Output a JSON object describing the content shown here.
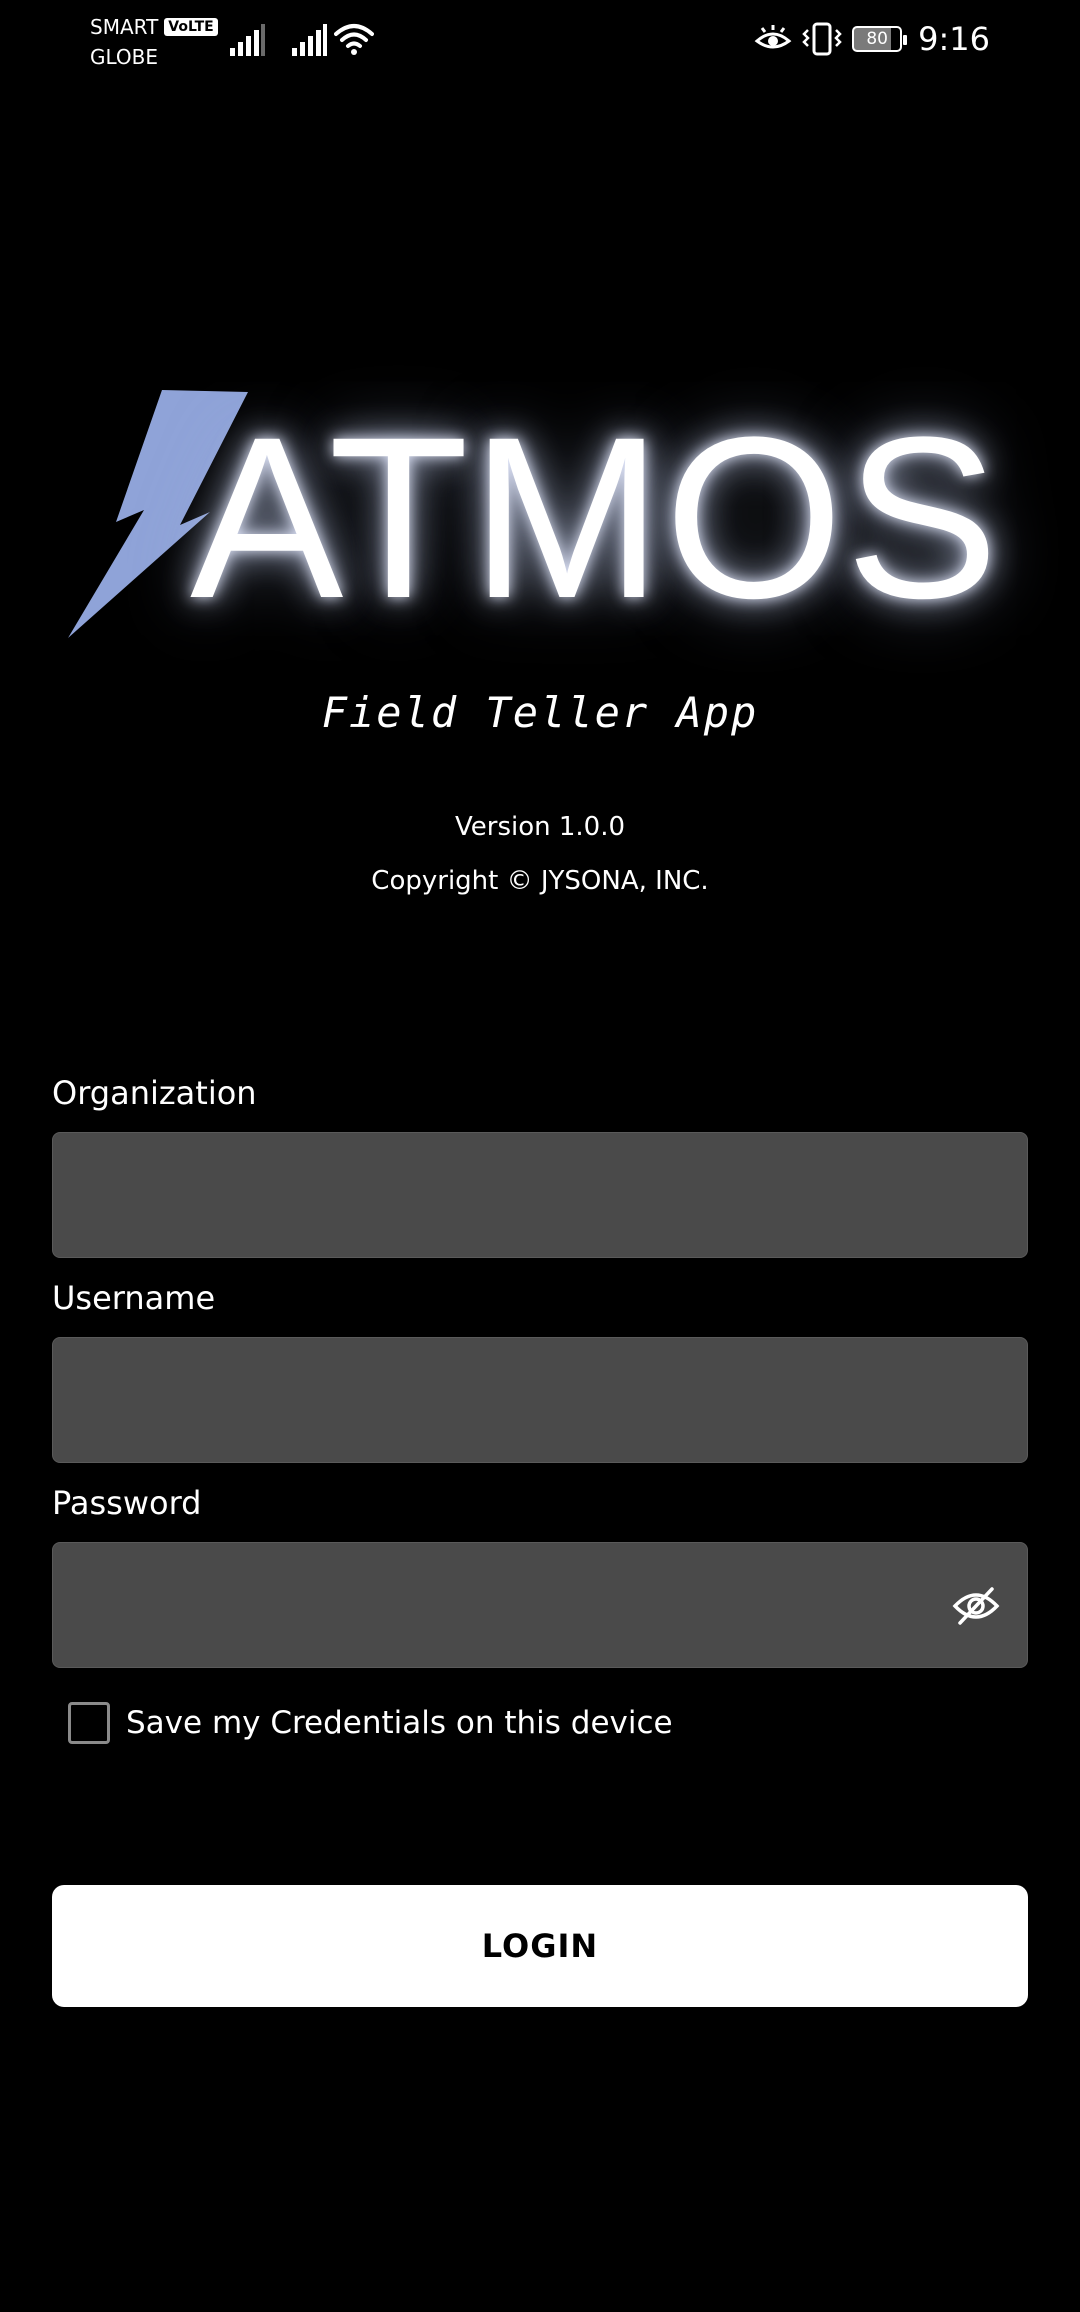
{
  "status_bar": {
    "carrier_1": "SMART",
    "volte": "VoLTE",
    "carrier_2": "GLOBE",
    "battery_level": "80",
    "time": "9:16",
    "icons": [
      "signal-icon",
      "signal-icon",
      "wifi-icon",
      "eye-comfort-icon",
      "vibrate-icon",
      "battery-icon"
    ]
  },
  "logo": {
    "text": "ATMOS",
    "bolt_color": "#8fa3d8"
  },
  "app": {
    "subtitle": "Field Teller App",
    "version": "Version 1.0.0",
    "copyright": "Copyright © JYSONA, INC."
  },
  "form": {
    "organization": {
      "label": "Organization",
      "value": "",
      "placeholder": ""
    },
    "username": {
      "label": "Username",
      "value": "",
      "placeholder": ""
    },
    "password": {
      "label": "Password",
      "value": "",
      "placeholder": ""
    },
    "save_credentials_label": "Save my Credentials on this device",
    "save_credentials_checked": false,
    "login_label": "LOGIN"
  },
  "colors": {
    "background": "#000000",
    "input_background": "#4a4a4a",
    "button_background": "#ffffff",
    "button_text": "#000000"
  }
}
